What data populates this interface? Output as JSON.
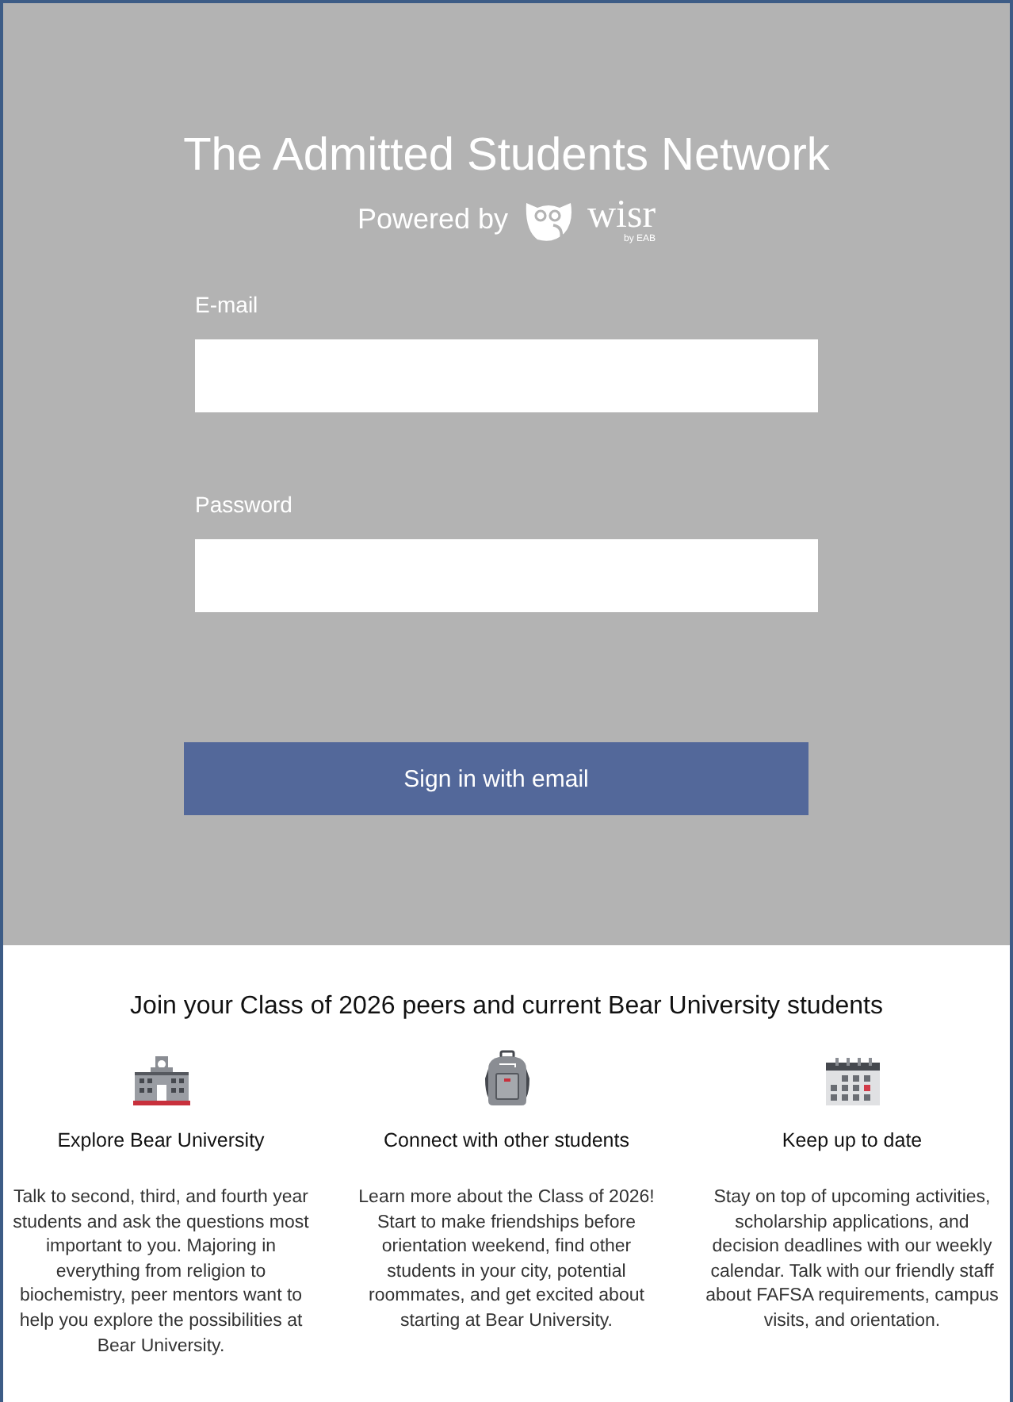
{
  "header": {
    "title": "The Admitted Students Network",
    "powered_by": "Powered by",
    "brand": "wisr",
    "brand_sub": "by EAB"
  },
  "form": {
    "fields": [
      {
        "label": "E-mail"
      },
      {
        "label": "Password"
      }
    ],
    "submit": "Sign in with email"
  },
  "info": {
    "heading": "Join your Class of 2026 peers and current Bear University students",
    "features": [
      {
        "kind": "building",
        "title": "Explore Bear University",
        "text": "Talk to second, third, and fourth year students and ask the questions most important to you. Majoring in everything from religion to biochemistry, peer mentors want to help you explore the possibilities at Bear University."
      },
      {
        "kind": "backpack",
        "title": "Connect with other students",
        "text": "Learn more about the Class of 2026! Start to make friendships before orientation weekend, find other students in your city, potential roommates, and get excited about starting at Bear University."
      },
      {
        "kind": "calendar",
        "title": "Keep up to date",
        "text": "Stay on top of upcoming activities, scholarship applications, and decision deadlines with our weekly calendar. Talk with our friendly staff about FAFSA requirements, campus visits, and orientation."
      }
    ]
  }
}
